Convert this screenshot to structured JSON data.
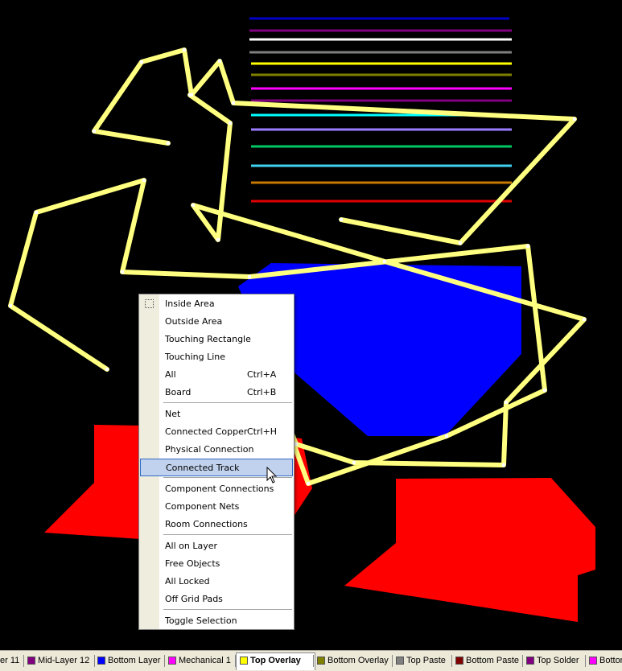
{
  "menu": {
    "items": [
      {
        "label": "Inside Area",
        "shortcut": "",
        "icon": "selection-box-icon"
      },
      {
        "label": "Outside Area",
        "shortcut": ""
      },
      {
        "label": "Touching Rectangle",
        "shortcut": ""
      },
      {
        "label": "Touching Line",
        "shortcut": ""
      },
      {
        "label": "All",
        "shortcut": "Ctrl+A"
      },
      {
        "label": "Board",
        "shortcut": "Ctrl+B"
      },
      {
        "label": "Net",
        "shortcut": ""
      },
      {
        "label": "Connected Copper",
        "shortcut": "Ctrl+H"
      },
      {
        "label": "Physical Connection",
        "shortcut": ""
      },
      {
        "label": "Connected Track",
        "shortcut": "",
        "highlighted": true
      },
      {
        "label": "Component Connections",
        "shortcut": ""
      },
      {
        "label": "Component Nets",
        "shortcut": ""
      },
      {
        "label": "Room Connections",
        "shortcut": ""
      },
      {
        "label": "All on Layer",
        "shortcut": ""
      },
      {
        "label": "Free Objects",
        "shortcut": ""
      },
      {
        "label": "All Locked",
        "shortcut": ""
      },
      {
        "label": "Off Grid Pads",
        "shortcut": ""
      },
      {
        "label": "Toggle Selection",
        "shortcut": ""
      }
    ]
  },
  "tabs": [
    {
      "label": "er 11",
      "color": "#800080"
    },
    {
      "label": "Mid-Layer 12",
      "color": "#800080"
    },
    {
      "label": "Bottom Layer",
      "color": "#0000ff"
    },
    {
      "label": "Mechanical 1",
      "color": "#ff00ff"
    },
    {
      "label": "Top Overlay",
      "color": "#ffff00",
      "active": true
    },
    {
      "label": "Bottom Overlay",
      "color": "#808000"
    },
    {
      "label": "Top Paste",
      "color": "#808080"
    },
    {
      "label": "Bottom Paste",
      "color": "#800000"
    },
    {
      "label": "Top Solder",
      "color": "#800080"
    },
    {
      "label": "Bottom",
      "color": "#ff00ff"
    }
  ],
  "layer_colors": {
    "background": "#000000",
    "overlay": "#ffff80",
    "bottom_copper": "#0000ff",
    "top_copper": "#ff0000",
    "line_colors": [
      "#0000c8",
      "#800080",
      "#ffffff",
      "#808080",
      "#ffff00",
      "#808000",
      "#ff00ff",
      "#800080",
      "#00ffff",
      "#9b7cff",
      "#00c864",
      "#40d0f0",
      "#c87800",
      "#e00000"
    ]
  }
}
